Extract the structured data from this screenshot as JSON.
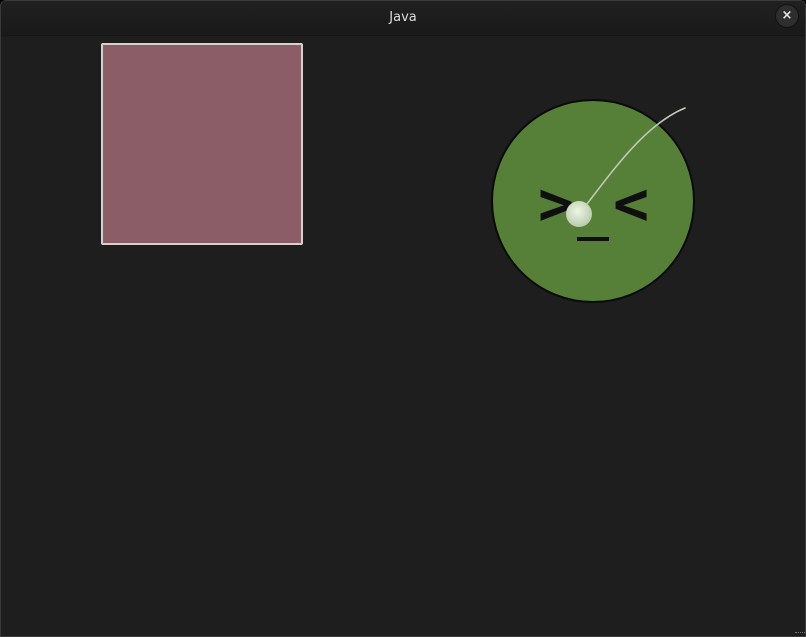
{
  "window": {
    "title": "Java",
    "close_glyph": "×"
  },
  "canvas": {
    "background": "#1e1e1e",
    "square_color": "#8b5e67",
    "square_border": "#d6d0d0",
    "face": {
      "color": "#567f37",
      "eyes_left": ">",
      "eyes_right": "<",
      "mouth": "_"
    },
    "ball_color": "#d9e6cf"
  }
}
